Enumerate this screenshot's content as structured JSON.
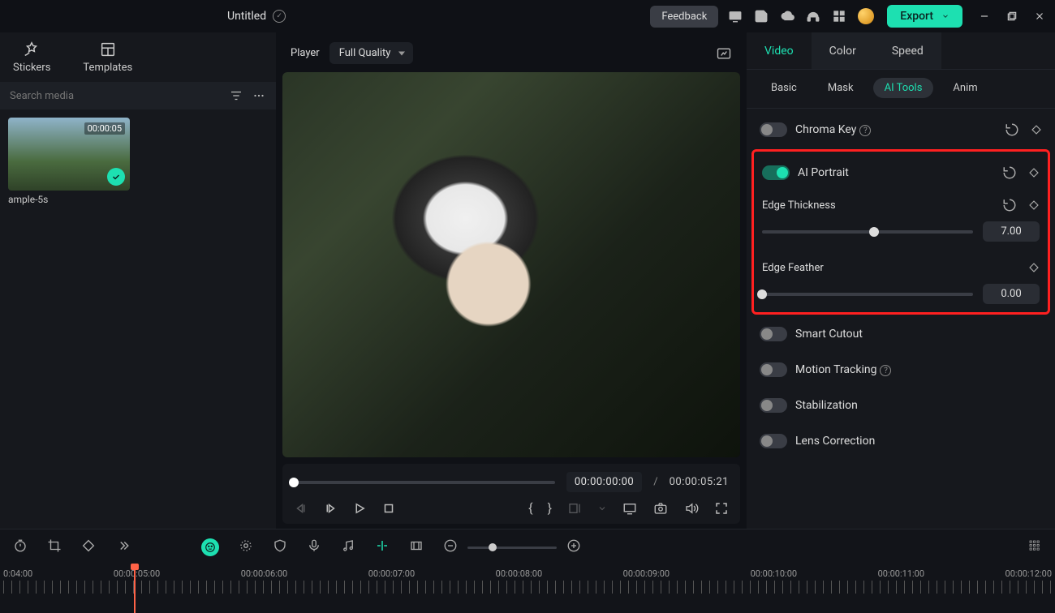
{
  "topbar": {
    "project_title": "Untitled",
    "feedback": "Feedback",
    "export": "Export"
  },
  "media_panel": {
    "tabs": {
      "stickers": "Stickers",
      "templates": "Templates"
    },
    "search_placeholder": "Search media",
    "item": {
      "duration": "00:00:05",
      "name": "ample-5s"
    }
  },
  "preview": {
    "player_label": "Player",
    "quality": "Full Quality",
    "time_current": "00:00:00:00",
    "time_sep": "/",
    "time_total": "00:00:05:21"
  },
  "props": {
    "main_tabs": {
      "video": "Video",
      "color": "Color",
      "speed": "Speed"
    },
    "sub_tabs": {
      "basic": "Basic",
      "mask": "Mask",
      "ai_tools": "AI Tools",
      "anim": "Anim"
    },
    "chroma_key": "Chroma Key",
    "ai_portrait": "AI Portrait",
    "edge_thickness": {
      "label": "Edge Thickness",
      "value": "7.00",
      "pct": 53
    },
    "edge_feather": {
      "label": "Edge Feather",
      "value": "0.00",
      "pct": 0
    },
    "smart_cutout": "Smart Cutout",
    "motion_tracking": "Motion Tracking",
    "stabilization": "Stabilization",
    "lens_correction": "Lens Correction"
  },
  "timeline": {
    "labels": [
      "0:04:00",
      "00:00:05:00",
      "00:00:06:00",
      "00:00:07:00",
      "00:00:08:00",
      "00:00:09:00",
      "00:00:10:00",
      "00:00:11:00",
      "00:00:12:00"
    ]
  }
}
